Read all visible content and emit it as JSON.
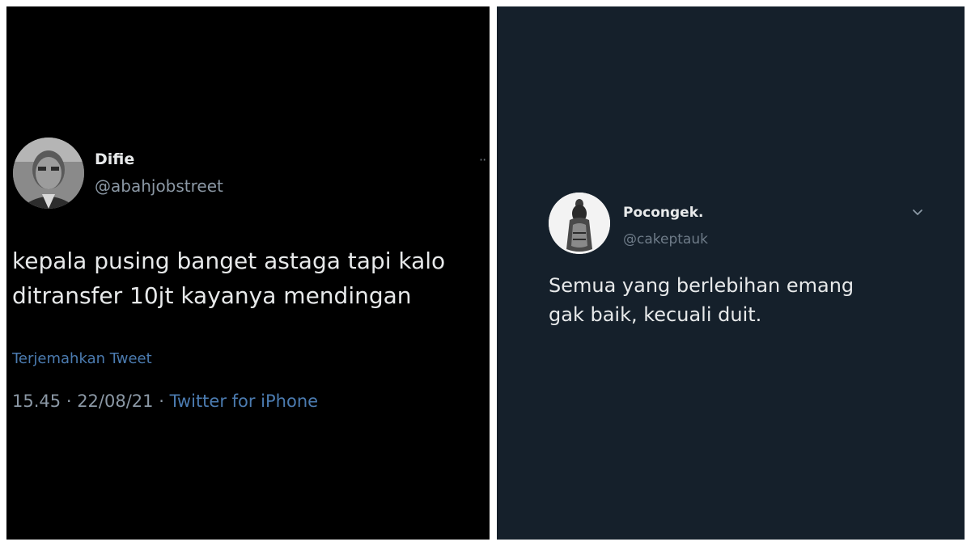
{
  "left_tweet": {
    "name": "Difie",
    "handle": "@abahjobstreet",
    "text_lines": [
      "kepala pusing banget astaga tapi kalo",
      "ditransfer 10jt kayanya mendingan"
    ],
    "translate_label": "Terjemahkan Tweet",
    "time": "15.45",
    "separator": "·",
    "date": "22/08/21",
    "source": "Twitter for iPhone",
    "more_label": "··"
  },
  "right_tweet": {
    "name": "Pocongek.",
    "handle": "@cakeptauk",
    "text_lines": [
      "Semua yang berlebihan emang",
      "gak baik, kecuali duit."
    ]
  },
  "icons": {
    "left_avatar": "user-avatar-icon",
    "right_avatar": "user-avatar-icon",
    "more": "more-icon",
    "chevron": "chevron-down-icon"
  },
  "colors": {
    "left_background": "#000000",
    "right_background": "#15202b",
    "link": "#4b7bb0",
    "primary_text": "#e7e9ea",
    "secondary_text": "#8b98a5"
  }
}
